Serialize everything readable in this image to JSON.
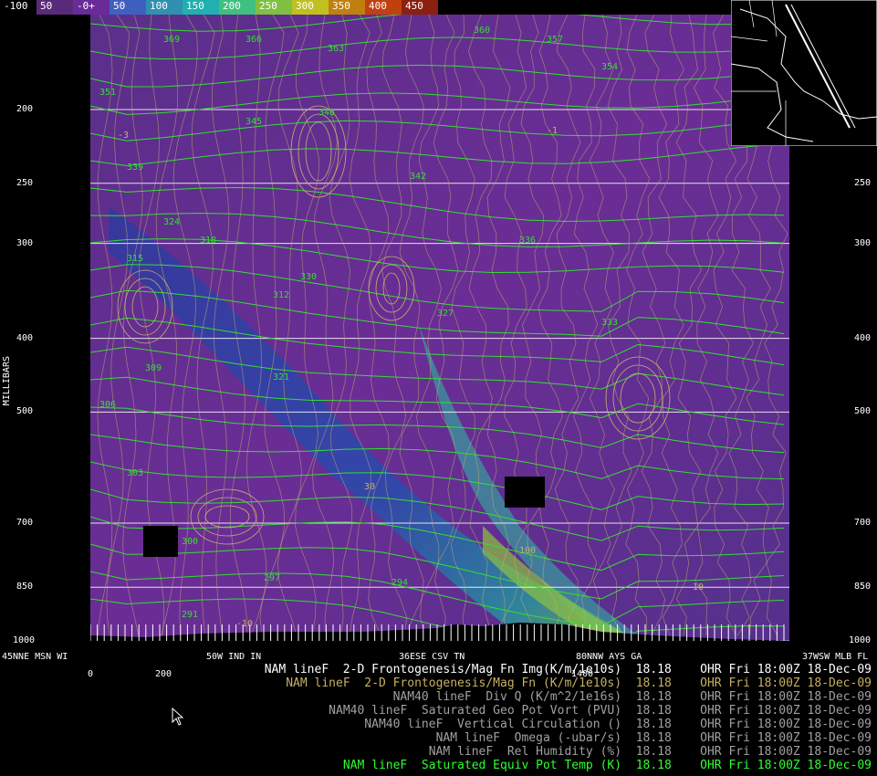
{
  "colorbar": {
    "labels": [
      "-100",
      "50",
      "-0+",
      "50",
      "100",
      "150",
      "200",
      "250",
      "300",
      "350",
      "400",
      "450"
    ],
    "colors": [
      "#000000",
      "#5a2a7a",
      "#6a2a9a",
      "#4060c0",
      "#3090b0",
      "#20b0b0",
      "#40c080",
      "#80c040",
      "#c0c020",
      "#c08010",
      "#c04010",
      "#8a2010"
    ]
  },
  "y_axis": {
    "label": "MILLIBARS",
    "ticks": [
      "200",
      "250",
      "300",
      "400",
      "500",
      "700",
      "850",
      "1000"
    ]
  },
  "x_axis": {
    "points": [
      "45NNE MSN WI",
      "50W IND IN",
      "36ESE CSV TN",
      "80NNW AYS GA",
      "37WSW MLB FL"
    ],
    "distances": [
      "0",
      "200",
      "1400"
    ]
  },
  "legend": [
    {
      "text": "NAM lineF  2-D Frontogenesis/Mag Fn Img(K/m/1e10s)  18.18    OHR Fri 18:00Z 18-Dec-09",
      "color": "#ffffff"
    },
    {
      "text": "NAM lineF  2-D Frontogenesis/Mag Fn (K/m/1e10s)  18.18    OHR Fri 18:00Z 18-Dec-09",
      "color": "#c8b060"
    },
    {
      "text": "NAM40 lineF  Div Q (K/m^2/1e16s)  18.18    OHR Fri 18:00Z 18-Dec-09",
      "color": "#a0a0a0"
    },
    {
      "text": "NAM40 lineF  Saturated Geo Pot Vort (PVU)  18.18    OHR Fri 18:00Z 18-Dec-09",
      "color": "#a0a0a0"
    },
    {
      "text": "NAM40 lineF  Vertical Circulation ()  18.18    OHR Fri 18:00Z 18-Dec-09",
      "color": "#a0a0a0"
    },
    {
      "text": "NAM lineF  Omega (-ubar/s)  18.18    OHR Fri 18:00Z 18-Dec-09",
      "color": "#a0a0a0"
    },
    {
      "text": "NAM lineF  Rel Humidity (%)  18.18    OHR Fri 18:00Z 18-Dec-09",
      "color": "#a0a0a0"
    },
    {
      "text": "NAM lineF  Saturated Equiv Pot Temp (K)  18.18    OHR Fri 18:00Z 18-Dec-09",
      "color": "#30ff30"
    }
  ],
  "contour_labels": [
    "369",
    "366",
    "363",
    "360",
    "357",
    "354",
    "351",
    "348",
    "345",
    "342",
    "339",
    "336",
    "333",
    "330",
    "327",
    "324",
    "321",
    "318",
    "315",
    "312",
    "309",
    "306",
    "303",
    "300",
    "297",
    "294",
    "291",
    "-10",
    "-3",
    "-1",
    "10",
    "30",
    "100"
  ]
}
